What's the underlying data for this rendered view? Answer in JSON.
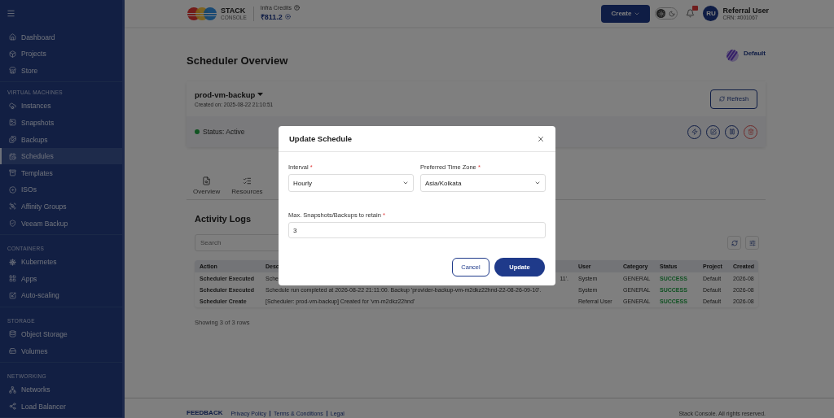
{
  "sidebar": {
    "groups": [
      {
        "items": [
          {
            "label": "Dashboard",
            "selected": false
          },
          {
            "label": "Projects",
            "selected": false
          },
          {
            "label": "Store",
            "selected": false
          }
        ]
      },
      {
        "heading": "VIRTUAL MACHINES",
        "items": [
          {
            "label": "Instances",
            "selected": false
          },
          {
            "label": "Snapshots",
            "selected": false
          },
          {
            "label": "Backups",
            "selected": false
          },
          {
            "label": "Schedules",
            "selected": true
          },
          {
            "label": "Templates",
            "selected": false
          },
          {
            "label": "ISOs",
            "selected": false
          },
          {
            "label": "Affinity Groups",
            "selected": false
          },
          {
            "label": "Veeam Backup",
            "selected": false
          }
        ]
      },
      {
        "heading": "CONTAINERS",
        "items": [
          {
            "label": "Kubernetes",
            "selected": false
          },
          {
            "label": "Apps",
            "selected": false
          },
          {
            "label": "Auto-scaling",
            "selected": false
          }
        ]
      },
      {
        "heading": "STORAGE",
        "items": [
          {
            "label": "Object Storage",
            "selected": false
          },
          {
            "label": "Volumes",
            "selected": false
          }
        ]
      },
      {
        "heading": "NETWORKING",
        "items": [
          {
            "label": "Networks",
            "selected": false
          },
          {
            "label": "Load Balancer",
            "selected": false
          }
        ]
      }
    ]
  },
  "header": {
    "logo": {
      "word": "STACK",
      "sub": "CONSOLE"
    },
    "credits": {
      "label": "Infra Credits",
      "value": "₹811.2"
    },
    "create_button": "Create",
    "theme_toggle": {
      "dark": false
    },
    "user": {
      "initials": "RU",
      "name": "Referral User",
      "crn": "CRN: #001067"
    }
  },
  "page": {
    "title": "Scheduler Overview",
    "project": "Default"
  },
  "schedule": {
    "name": "prod-vm-backup",
    "created": "Created on: 2025-08-22 21:10:51",
    "refresh": "Refresh",
    "status": "Status: Active",
    "active": true
  },
  "tabs": [
    {
      "label": "Overview"
    },
    {
      "label": "Resources"
    }
  ],
  "activity": {
    "title": "Activity Logs",
    "search_placeholder": "Search",
    "columns": [
      "Action",
      "Desc",
      "User",
      "Category",
      "Status",
      "Project",
      "Created"
    ],
    "rows": [
      {
        "action": "Scheduler Executed",
        "description": "Sche",
        "description_end": "11'.",
        "user": "System",
        "category": "GENERAL",
        "status": "SUCCESS",
        "project": "Default",
        "created": "2026-08"
      },
      {
        "action": "Scheduler Executed",
        "description": "Schedule run completed at 2026-08-22 21:11:00. Backup 'provider-backup-vm-m2dkz22hnd-22-08-26-09-10'.",
        "user": "System",
        "category": "GENERAL",
        "status": "SUCCESS",
        "project": "Default",
        "created": "2026-08"
      },
      {
        "action": "Scheduler Create",
        "description": "[Scheduler: prod-vm-backup] Created for 'vm-m2dkz22hnd'",
        "user": "Referral User",
        "category": "GENERAL",
        "status": "SUCCESS",
        "project": "Default",
        "created": "2026-08"
      }
    ],
    "summary": "Showing 3 of 3 rows"
  },
  "footer": {
    "feedback": "FEEDBACK",
    "links": [
      "Privacy Policy",
      "Terms & Conditions",
      "Legal"
    ],
    "copyright": "Stack Console. All rights reserved."
  },
  "modal": {
    "title": "Update Schedule",
    "fields": [
      {
        "kind": "select",
        "label": "Interval",
        "required_mark": "*",
        "value": "Hourly"
      },
      {
        "kind": "select",
        "label": "Preferred Time Zone",
        "required_mark": "*",
        "value": "Asia/Kolkata"
      },
      {
        "kind": "input",
        "label": "Max. Snapshots/Backups to retain",
        "required_mark": "*",
        "value": "3"
      }
    ],
    "cancel": "Cancel",
    "submit": "Update"
  }
}
